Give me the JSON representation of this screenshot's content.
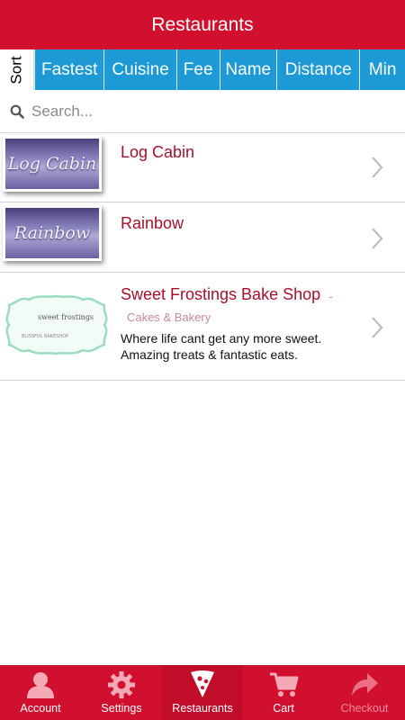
{
  "header": {
    "title": "Restaurants"
  },
  "sort": {
    "label": "Sort",
    "options": [
      "Fastest",
      "Cuisine",
      "Fee",
      "Name",
      "Distance",
      "Min"
    ]
  },
  "search": {
    "placeholder": "Search..."
  },
  "restaurants": [
    {
      "name": "Log Cabin",
      "logo_text": "Log Cabin"
    },
    {
      "name": "Rainbow",
      "logo_text": "Rainbow"
    },
    {
      "name": "Sweet Frostings Bake Shop",
      "separator": "-",
      "category": "Cakes & Bakery",
      "description": "Where life cant get any more sweet. Amazing treats & fantastic eats.",
      "logo_text": "sweet frostings",
      "logo_subtext": "BLISSFUL BAKESHOP"
    }
  ],
  "tabs": [
    {
      "label": "Account",
      "icon": "person-icon"
    },
    {
      "label": "Settings",
      "icon": "gear-icon"
    },
    {
      "label": "Restaurants",
      "icon": "pizza-slice-icon",
      "active": true
    },
    {
      "label": "Cart",
      "icon": "cart-icon"
    },
    {
      "label": "Checkout",
      "icon": "forward-arrow-icon",
      "disabled": true
    }
  ],
  "colors": {
    "brand": "#d0102e",
    "sort_bar": "#1d9ad6",
    "restaurant_name": "#a5112b"
  }
}
